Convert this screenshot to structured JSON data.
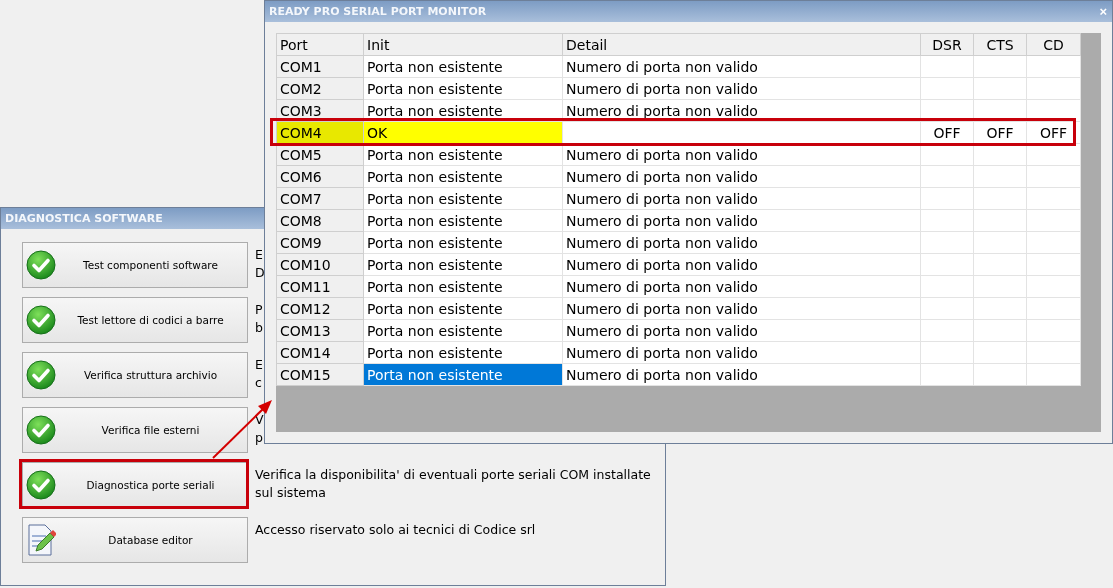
{
  "diagnostics_window": {
    "title": "DIAGNOSTICA SOFTWARE",
    "items": [
      {
        "label": "Test componenti software",
        "kind": "check",
        "marked": false,
        "description": [
          "E",
          "D"
        ]
      },
      {
        "label": "Test lettore di codici a barre",
        "kind": "check",
        "marked": false,
        "description": [
          "P",
          "b"
        ]
      },
      {
        "label": "Verifica struttura archivio",
        "kind": "check",
        "marked": false,
        "description": [
          "E",
          "c"
        ]
      },
      {
        "label": "Verifica file esterni",
        "kind": "check",
        "marked": false,
        "description": [
          "V",
          "p"
        ]
      },
      {
        "label": "Diagnostica porte seriali",
        "kind": "check",
        "marked": true,
        "description": [
          "Verifica la disponibilita' di eventuali porte seriali COM installate",
          "sul sistema"
        ]
      },
      {
        "label": "Database editor",
        "kind": "editor",
        "marked": false,
        "description": [
          "Accesso riservato solo ai tecnici di Codice srl"
        ]
      }
    ]
  },
  "monitor_window": {
    "title": "READY PRO SERIAL PORT MONITOR",
    "close": "×",
    "columns": [
      "Port",
      "Init",
      "Detail",
      "DSR",
      "CTS",
      "CD"
    ],
    "rows": [
      {
        "port": "COM1",
        "init": "Porta non esistente",
        "detail": "Numero di porta non valido",
        "highlighted": false,
        "marked": false,
        "selected": false
      },
      {
        "port": "COM2",
        "init": "Porta non esistente",
        "detail": "Numero di porta non valido",
        "highlighted": false,
        "marked": false,
        "selected": false
      },
      {
        "port": "COM3",
        "init": "Porta non esistente",
        "detail": "Numero di porta non valido",
        "highlighted": false,
        "marked": false,
        "selected": false
      },
      {
        "port": "COM4",
        "init": "OK",
        "dsr": "OFF",
        "cts": "OFF",
        "cd": "OFF",
        "highlighted": true,
        "marked": true,
        "selected": false
      },
      {
        "port": "COM5",
        "init": "Porta non esistente",
        "detail": "Numero di porta non valido",
        "highlighted": false,
        "marked": false,
        "selected": false
      },
      {
        "port": "COM6",
        "init": "Porta non esistente",
        "detail": "Numero di porta non valido",
        "highlighted": false,
        "marked": false,
        "selected": false
      },
      {
        "port": "COM7",
        "init": "Porta non esistente",
        "detail": "Numero di porta non valido",
        "highlighted": false,
        "marked": false,
        "selected": false
      },
      {
        "port": "COM8",
        "init": "Porta non esistente",
        "detail": "Numero di porta non valido",
        "highlighted": false,
        "marked": false,
        "selected": false
      },
      {
        "port": "COM9",
        "init": "Porta non esistente",
        "detail": "Numero di porta non valido",
        "highlighted": false,
        "marked": false,
        "selected": false
      },
      {
        "port": "COM10",
        "init": "Porta non esistente",
        "detail": "Numero di porta non valido",
        "highlighted": false,
        "marked": false,
        "selected": false
      },
      {
        "port": "COM11",
        "init": "Porta non esistente",
        "detail": "Numero di porta non valido",
        "highlighted": false,
        "marked": false,
        "selected": false
      },
      {
        "port": "COM12",
        "init": "Porta non esistente",
        "detail": "Numero di porta non valido",
        "highlighted": false,
        "marked": false,
        "selected": false
      },
      {
        "port": "COM13",
        "init": "Porta non esistente",
        "detail": "Numero di porta non valido",
        "highlighted": false,
        "marked": false,
        "selected": false
      },
      {
        "port": "COM14",
        "init": "Porta non esistente",
        "detail": "Numero di porta non valido",
        "highlighted": false,
        "marked": false,
        "selected": false
      },
      {
        "port": "COM15",
        "init": "Porta non esistente",
        "detail": "Numero di porta non valido",
        "highlighted": false,
        "marked": false,
        "selected": true
      }
    ]
  }
}
